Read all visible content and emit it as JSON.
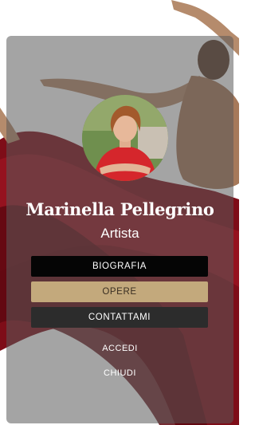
{
  "profile": {
    "name": "Marinella Pellegrino",
    "role": "Artista"
  },
  "menu": {
    "bio_label": "BIOGRAFIA",
    "works_label": "OPERE",
    "contact_label": "CONTATTAMI"
  },
  "actions": {
    "login_label": "ACCEDI",
    "close_label": "CHIUDI"
  },
  "colors": {
    "bio_button": "#050505",
    "works_button": "#c3a97c",
    "contact_button": "#2c2c2c",
    "dress_red": "#8b0f1c"
  },
  "icons": {
    "background": "dancer-artwork",
    "avatar": "profile-photo"
  }
}
